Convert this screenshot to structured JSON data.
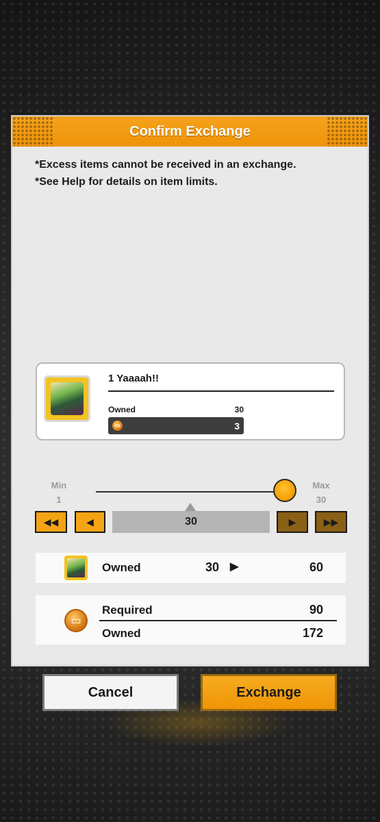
{
  "dialog": {
    "title": "Confirm Exchange",
    "notes": [
      "*Excess items cannot be received in an exchange.",
      "*See Help for details on item limits."
    ]
  },
  "item": {
    "name": "1 Yaaaah!!",
    "owned_label": "Owned",
    "owned_value": "30",
    "cost_value": "3",
    "cost_icon": "coin-icon"
  },
  "quantity": {
    "min_label": "Min",
    "min_value": "1",
    "max_label": "Max",
    "max_value": "30",
    "current": "30",
    "slider_fraction": 1.0
  },
  "summary": {
    "item_owned_label": "Owned",
    "item_owned_before": "30",
    "item_owned_after": "60",
    "required_label": "Required",
    "required_value": "90",
    "currency_owned_label": "Owned",
    "currency_owned_value": "172"
  },
  "buttons": {
    "cancel": "Cancel",
    "exchange": "Exchange"
  },
  "colors": {
    "accent": "#f4a414",
    "panel": "#e9e9e9"
  }
}
